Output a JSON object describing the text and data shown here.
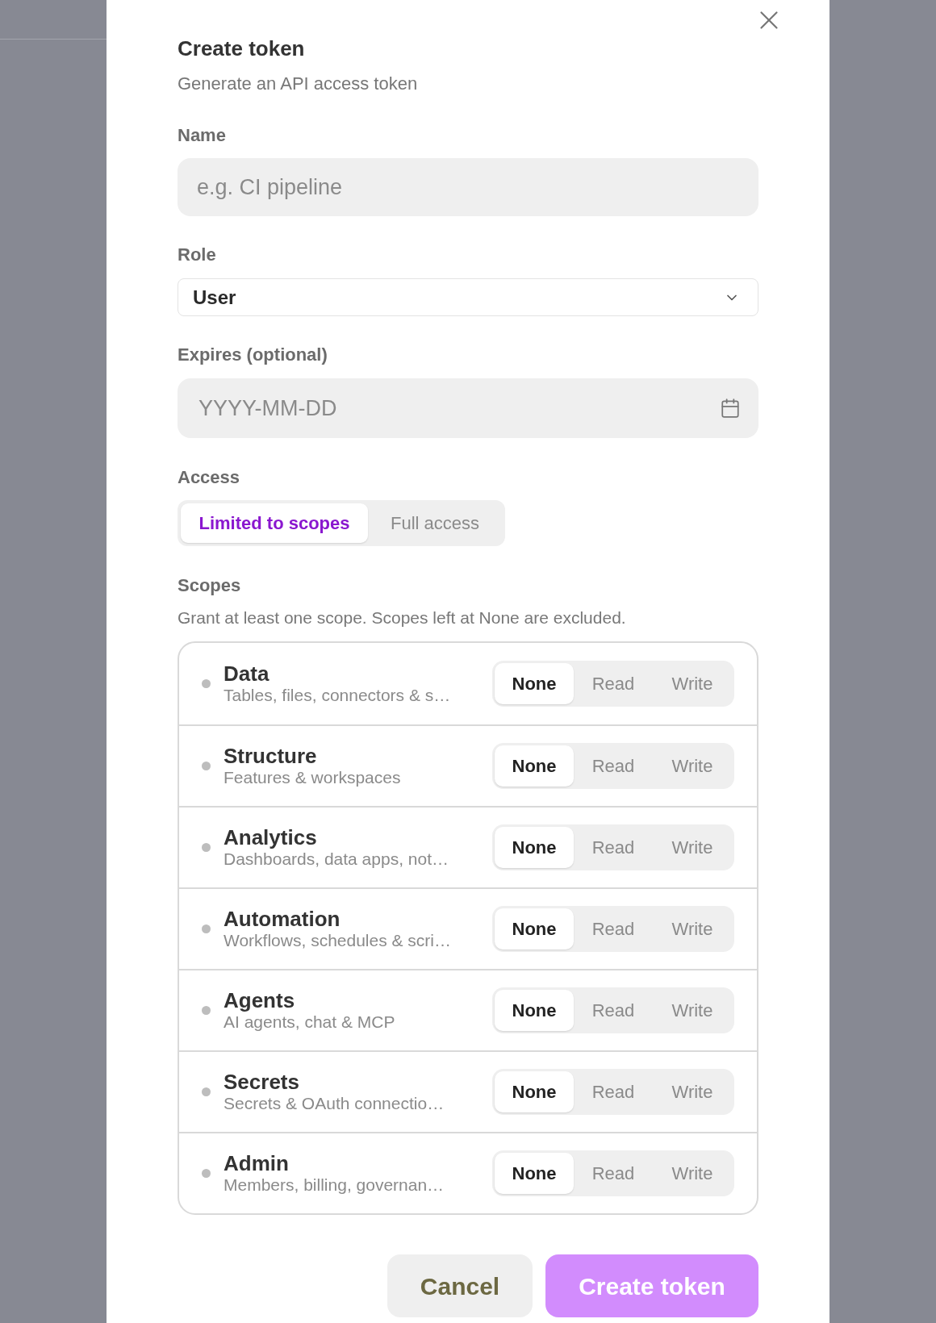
{
  "dialog": {
    "title": "Create token",
    "subtitle": "Generate an API access token"
  },
  "name": {
    "label": "Name",
    "placeholder": "e.g. CI pipeline"
  },
  "role": {
    "label": "Role",
    "value": "User"
  },
  "expires": {
    "label": "Expires (optional)",
    "placeholder": "YYYY-MM-DD"
  },
  "access": {
    "label": "Access",
    "options": [
      {
        "label": "Limited to scopes",
        "selected": true
      },
      {
        "label": "Full access",
        "selected": false
      }
    ]
  },
  "scopes": {
    "label": "Scopes",
    "description": "Grant at least one scope. Scopes left at None are excluded.",
    "items": [
      {
        "name": "Data",
        "description": "Tables, files, connectors & s…",
        "levels": [
          {
            "label": "None",
            "selected": true
          },
          {
            "label": "Read",
            "selected": false
          },
          {
            "label": "Write",
            "selected": false
          }
        ]
      },
      {
        "name": "Structure",
        "description": "Features & workspaces",
        "levels": [
          {
            "label": "None",
            "selected": true
          },
          {
            "label": "Read",
            "selected": false
          },
          {
            "label": "Write",
            "selected": false
          }
        ]
      },
      {
        "name": "Analytics",
        "description": "Dashboards, data apps, not…",
        "levels": [
          {
            "label": "None",
            "selected": true
          },
          {
            "label": "Read",
            "selected": false
          },
          {
            "label": "Write",
            "selected": false
          }
        ]
      },
      {
        "name": "Automation",
        "description": "Workflows, schedules & scri…",
        "levels": [
          {
            "label": "None",
            "selected": true
          },
          {
            "label": "Read",
            "selected": false
          },
          {
            "label": "Write",
            "selected": false
          }
        ]
      },
      {
        "name": "Agents",
        "description": "AI agents, chat & MCP",
        "levels": [
          {
            "label": "None",
            "selected": true
          },
          {
            "label": "Read",
            "selected": false
          },
          {
            "label": "Write",
            "selected": false
          }
        ]
      },
      {
        "name": "Secrets",
        "description": "Secrets & OAuth connectio…",
        "levels": [
          {
            "label": "None",
            "selected": true
          },
          {
            "label": "Read",
            "selected": false
          },
          {
            "label": "Write",
            "selected": false
          }
        ]
      },
      {
        "name": "Admin",
        "description": "Members, billing, governan…",
        "levels": [
          {
            "label": "None",
            "selected": true
          },
          {
            "label": "Read",
            "selected": false
          },
          {
            "label": "Write",
            "selected": false
          }
        ]
      }
    ]
  },
  "buttons": [
    {
      "label": "Cancel",
      "kind": "secondary"
    },
    {
      "label": "Create token",
      "kind": "primary"
    }
  ]
}
